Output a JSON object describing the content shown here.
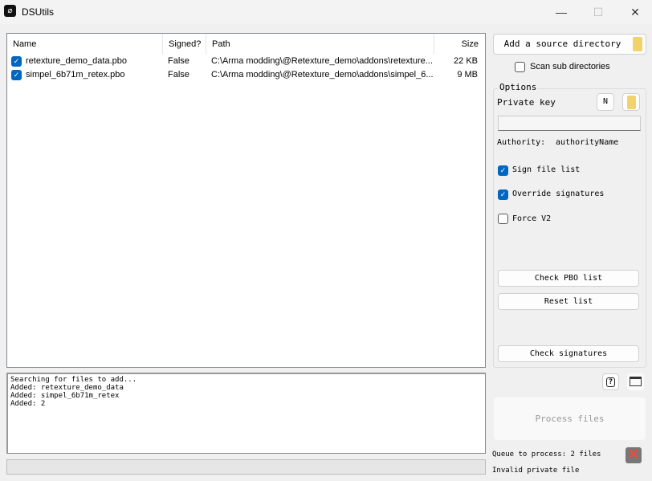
{
  "window": {
    "title": "DSUtils",
    "minimize": "—",
    "maximize": "☐",
    "close": "✕"
  },
  "table": {
    "columns": [
      "Name",
      "Signed?",
      "Path",
      "Size"
    ],
    "rows": [
      {
        "checked": true,
        "name": "retexture_demo_data.pbo",
        "signed": "False",
        "path": "C:\\Arma modding\\@Retexture_demo\\addons\\retexture...",
        "size": "22 KB"
      },
      {
        "checked": true,
        "name": "simpel_6b71m_retex.pbo",
        "signed": "False",
        "path": "C:\\Arma modding\\@Retexture_demo\\addons\\simpel_6...",
        "size": "9 MB"
      }
    ]
  },
  "log": {
    "lines": [
      "Searching for files to add...",
      "Added: retexture_demo_data",
      "Added: simpel_6b71m_retex",
      "Added: 2"
    ]
  },
  "side": {
    "add_source": "Add a source directory",
    "scan_sub": "Scan sub directories",
    "options_title": "Options",
    "private_key": "Private key",
    "new_key": "N",
    "key_path": "",
    "authority_label": "Authority:",
    "authority_value": "authorityName",
    "sign_file_list": "Sign file list",
    "override_signatures": "Override signatures",
    "force_v2": "Force V2",
    "check_pbo": "Check PBO list",
    "reset_list": "Reset list",
    "check_signatures": "Check signatures",
    "help": "?",
    "process_files": "Process files",
    "queue": "Queue to process: 2 files",
    "error": "Invalid private file"
  },
  "colors": {
    "accent": "#0067c0",
    "error": "#e74c3c"
  }
}
